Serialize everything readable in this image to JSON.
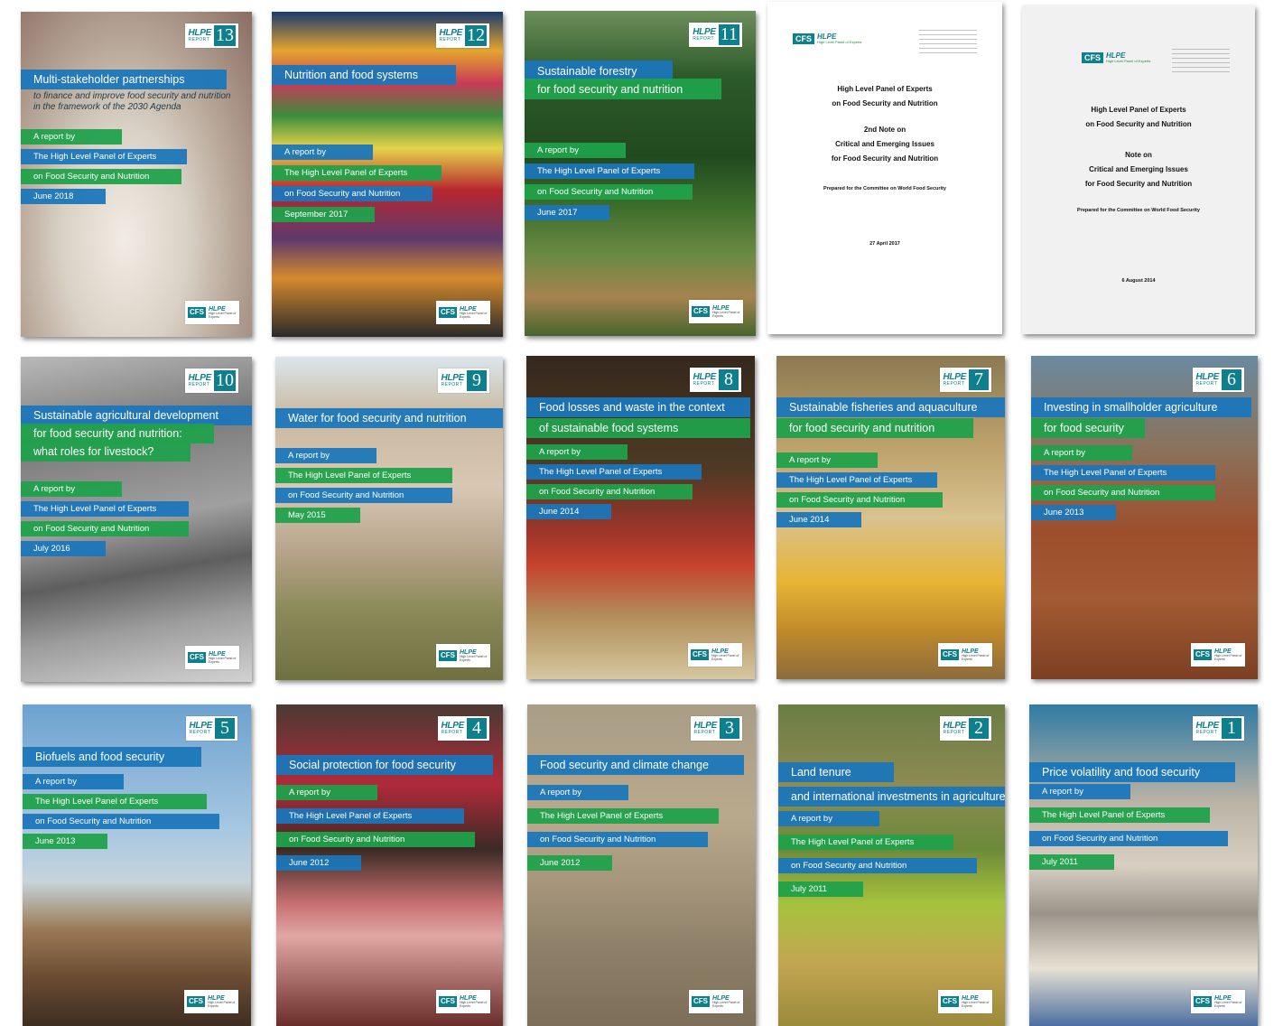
{
  "common": {
    "hlpe": "HLPE",
    "report": "REPORT",
    "a_report_by": "A report by",
    "panel_line_1": "The High Level Panel of Experts",
    "panel_line_2": "on Food Security and Nutrition",
    "cfs": "CFS",
    "hlpe_small": "HLPE",
    "hlpe_sub": "High Level Panel of Experts"
  },
  "covers": [
    {
      "number": "13",
      "title_lines": [
        "Multi-stakeholder partnerships"
      ],
      "subtitle_lines": [
        "to finance and improve food security and nutrition",
        "in the framework of the 2030 Agenda"
      ],
      "date": "June 2018"
    },
    {
      "number": "12",
      "title_lines": [
        "Nutrition and food systems"
      ],
      "date": "September 2017"
    },
    {
      "number": "11",
      "title_lines": [
        "Sustainable forestry",
        "for food security and nutrition"
      ],
      "date": "June 2017"
    },
    {
      "number": "10",
      "title_lines": [
        "Sustainable agricultural development",
        "for food security and nutrition:",
        "what roles for livestock?"
      ],
      "date": "July 2016"
    },
    {
      "number": "9",
      "title_lines": [
        "Water for food security and nutrition"
      ],
      "date": "May 2015"
    },
    {
      "number": "8",
      "title_lines": [
        "Food losses and waste in the context",
        "of sustainable food systems"
      ],
      "date": "June 2014"
    },
    {
      "number": "7",
      "title_lines": [
        "Sustainable fisheries and aquaculture",
        "for food security and nutrition"
      ],
      "date": "June 2014"
    },
    {
      "number": "6",
      "title_lines": [
        "Investing in smallholder agriculture",
        "for food security"
      ],
      "date": "June 2013"
    },
    {
      "number": "5",
      "title_lines": [
        "Biofuels and food security"
      ],
      "date": "June 2013"
    },
    {
      "number": "4",
      "title_lines": [
        "Social protection for food security"
      ],
      "date": "June 2012"
    },
    {
      "number": "3",
      "title_lines": [
        "Food security and climate change"
      ],
      "date": "June 2012"
    },
    {
      "number": "2",
      "title_lines": [
        "Land tenure",
        "and international investments in agriculture"
      ],
      "date": "July 2011"
    },
    {
      "number": "1",
      "title_lines": [
        "Price volatility and food security"
      ],
      "date": "July 2011"
    }
  ],
  "notes": [
    {
      "title_lines": [
        "High Level Panel of Experts",
        "on Food Security and Nutrition"
      ],
      "note_lines": [
        "2nd Note on",
        "Critical and Emerging Issues",
        "for Food Security and Nutrition"
      ],
      "prepared": "Prepared for the Committee on World Food Security",
      "date": "27 April 2017"
    },
    {
      "title_lines": [
        "High Level Panel of Experts",
        "on Food Security and Nutrition"
      ],
      "note_lines": [
        "Note on",
        "Critical and Emerging Issues",
        "for Food Security and Nutrition"
      ],
      "prepared": "Prepared for the Committee on World Food Security",
      "date": "6 August 2014"
    }
  ],
  "colors": {
    "blue_bar": "#1b76ba",
    "green_bar": "#1fa24a",
    "badge_teal": "#0e7f8c"
  }
}
